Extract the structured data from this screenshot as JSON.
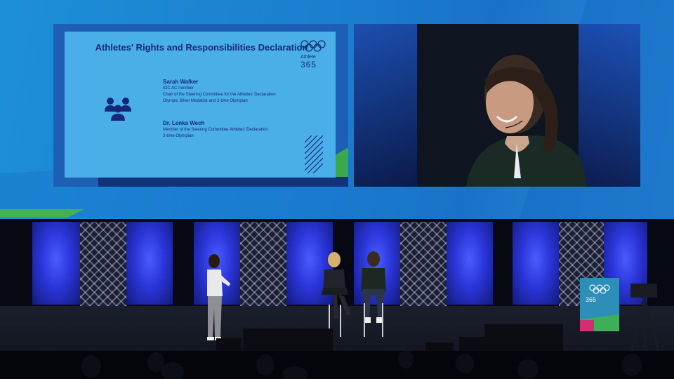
{
  "scene": {
    "description_type": "photo of a panel discussion on a stage with a projected slide and live video"
  },
  "slide": {
    "title": "Athletes' Rights and Responsibilities Declaration",
    "brand_label": "Athlete",
    "brand_number": "365",
    "speakers": [
      {
        "name": "Sarah Walker",
        "lines": [
          "IOC AC member",
          "Chair of the Steering Committee for the Athletes' Declaration",
          "Olympic Silver Medallist and 2-time Olympian"
        ]
      },
      {
        "name": "Dr. Lenka Wech",
        "lines": [
          "Member of the Steering Committee Athletes' Declaration",
          "3-time Olympian"
        ]
      }
    ],
    "icons": [
      "olympic-rings-icon",
      "people-group-icon"
    ]
  },
  "stage_sign": {
    "text": "365"
  },
  "colors": {
    "screen_blue": "#1d8fd8",
    "slide_blue": "#4aaee8",
    "title_navy": "#14287a",
    "accent_green": "#3aa94c",
    "stage_light": "#2a35d8"
  }
}
